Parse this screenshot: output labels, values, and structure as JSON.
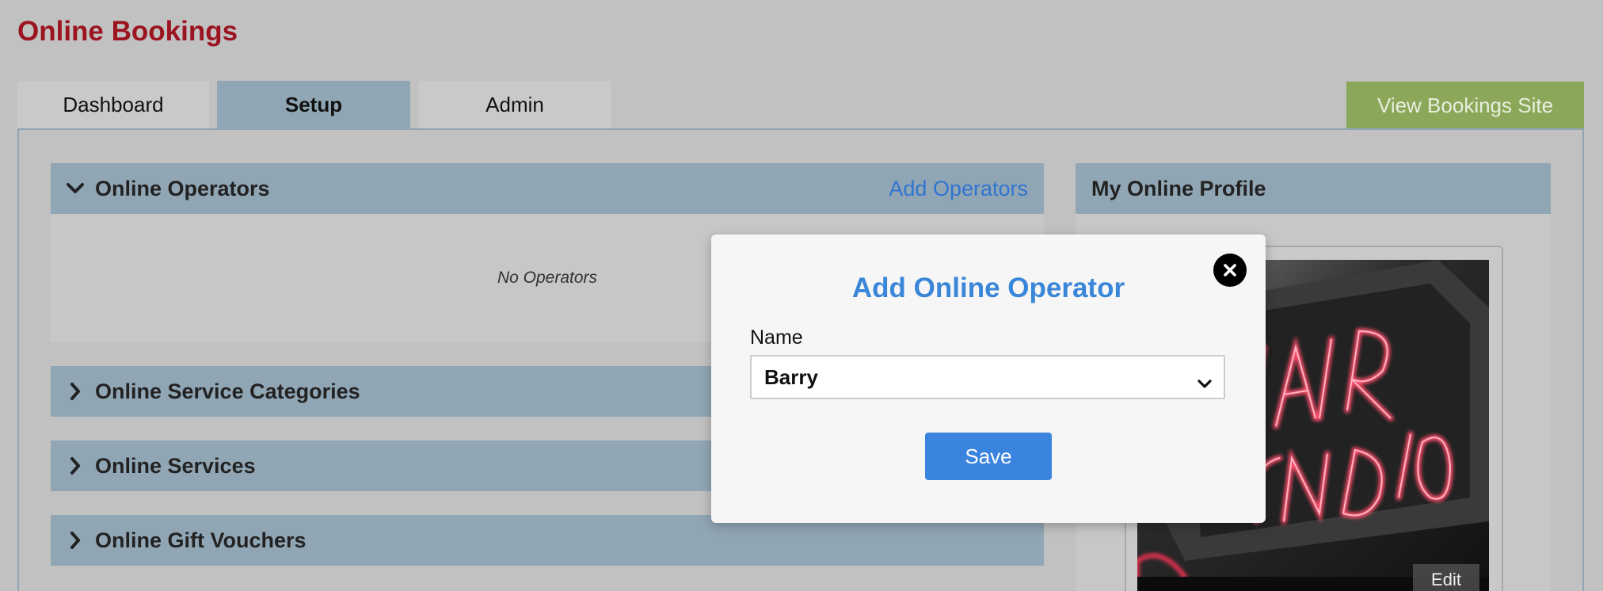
{
  "page": {
    "title": "Online Bookings"
  },
  "tabs": [
    {
      "label": "Dashboard",
      "active": false
    },
    {
      "label": "Setup",
      "active": true
    },
    {
      "label": "Admin",
      "active": false
    }
  ],
  "view_site_label": "View Bookings Site",
  "sections": [
    {
      "label": "Online Operators",
      "expanded": true,
      "action": "Add Operators",
      "empty_text": "No Operators"
    },
    {
      "label": "Online Service Categories",
      "expanded": false
    },
    {
      "label": "Online Services",
      "expanded": false
    },
    {
      "label": "Online Gift Vouchers",
      "expanded": false
    }
  ],
  "profile": {
    "title": "My Online Profile",
    "edit_label": "Edit"
  },
  "modal": {
    "title": "Add Online Operator",
    "name_label": "Name",
    "name_value": "Barry",
    "save_label": "Save"
  },
  "colors": {
    "brand": "#9b1420",
    "accent": "#3a86d9",
    "header_bg": "#91a6b5",
    "view_site_bg": "#8ba85a"
  },
  "icons": {
    "expanded": "chevron-down-icon",
    "collapsed": "chevron-right-icon",
    "close": "close-icon",
    "select": "chevron-down-icon"
  }
}
